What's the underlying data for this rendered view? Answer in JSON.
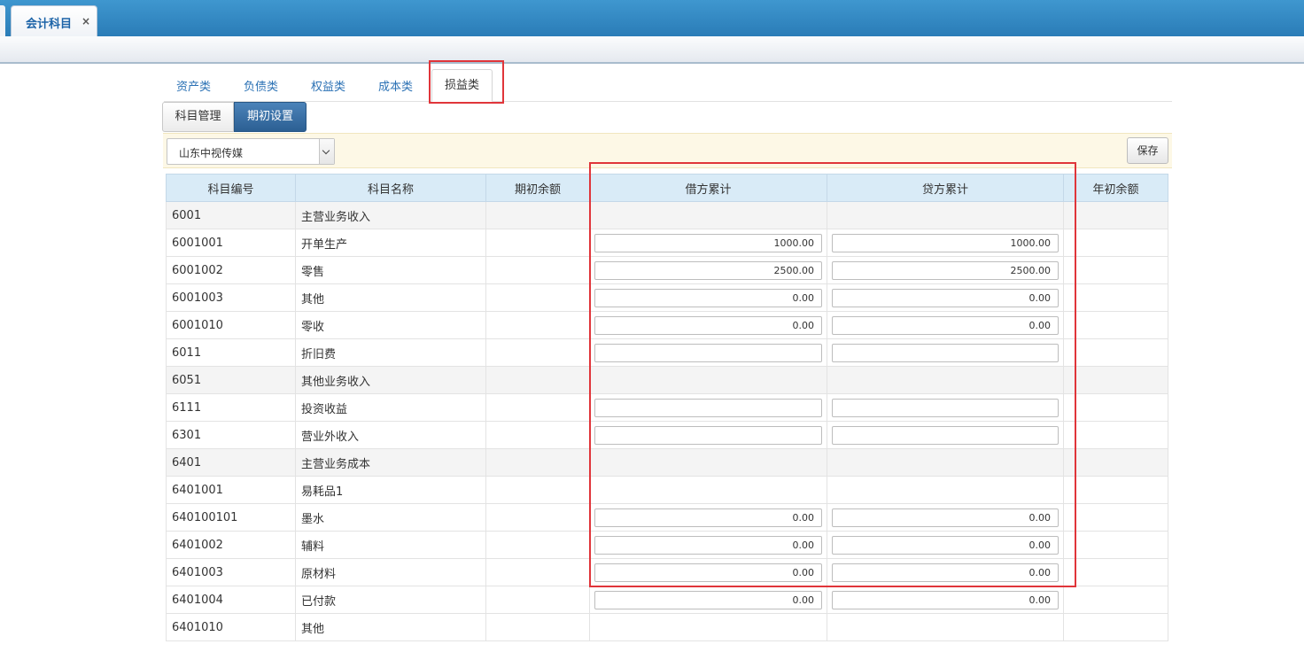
{
  "header": {
    "tab_label": "会计科目",
    "close_symbol": "×"
  },
  "category_tabs": [
    {
      "label": "资产类"
    },
    {
      "label": "负债类"
    },
    {
      "label": "权益类"
    },
    {
      "label": "成本类"
    },
    {
      "label": "损益类",
      "active": true
    }
  ],
  "mode_buttons": {
    "manage_label": "科目管理",
    "opening_label": "期初设置"
  },
  "toolbar": {
    "company_selected": "山东中视传媒",
    "save_label": "保存"
  },
  "table": {
    "columns": [
      "科目编号",
      "科目名称",
      "期初余额",
      "借方累计",
      "贷方累计",
      "年初余额"
    ],
    "rows": [
      {
        "code": "6001",
        "name": "主营业务收入",
        "group": true
      },
      {
        "code": "6001001",
        "name": "开单生产",
        "debit": "1000.00",
        "credit": "1000.00"
      },
      {
        "code": "6001002",
        "name": "零售",
        "debit": "2500.00",
        "credit": "2500.00"
      },
      {
        "code": "6001003",
        "name": "其他",
        "debit": "0.00",
        "credit": "0.00"
      },
      {
        "code": "6001010",
        "name": "零收",
        "debit": "0.00",
        "credit": "0.00"
      },
      {
        "code": "6011",
        "name": "折旧费",
        "debit": "",
        "credit": ""
      },
      {
        "code": "6051",
        "name": "其他业务收入",
        "group": true
      },
      {
        "code": "6111",
        "name": "投资收益",
        "debit": "",
        "credit": ""
      },
      {
        "code": "6301",
        "name": "营业外收入",
        "debit": "",
        "credit": ""
      },
      {
        "code": "6401",
        "name": "主营业务成本",
        "group": true
      },
      {
        "code": "6401001",
        "name": "易耗品1",
        "noinput": true
      },
      {
        "code": "640100101",
        "name": "墨水",
        "debit": "0.00",
        "credit": "0.00"
      },
      {
        "code": "6401002",
        "name": "辅料",
        "debit": "0.00",
        "credit": "0.00"
      },
      {
        "code": "6401003",
        "name": "原材料",
        "debit": "0.00",
        "credit": "0.00"
      },
      {
        "code": "6401004",
        "name": "已付款",
        "debit": "0.00",
        "credit": "0.00"
      },
      {
        "code": "6401010",
        "name": "其他",
        "noinput": true
      }
    ]
  },
  "colors": {
    "header_blue": "#2a7cb7",
    "primary_button": "#2c5f93",
    "table_header": "#d9ebf7",
    "toolbar_bg": "#fdf8e6",
    "highlight": "#e0353a"
  }
}
